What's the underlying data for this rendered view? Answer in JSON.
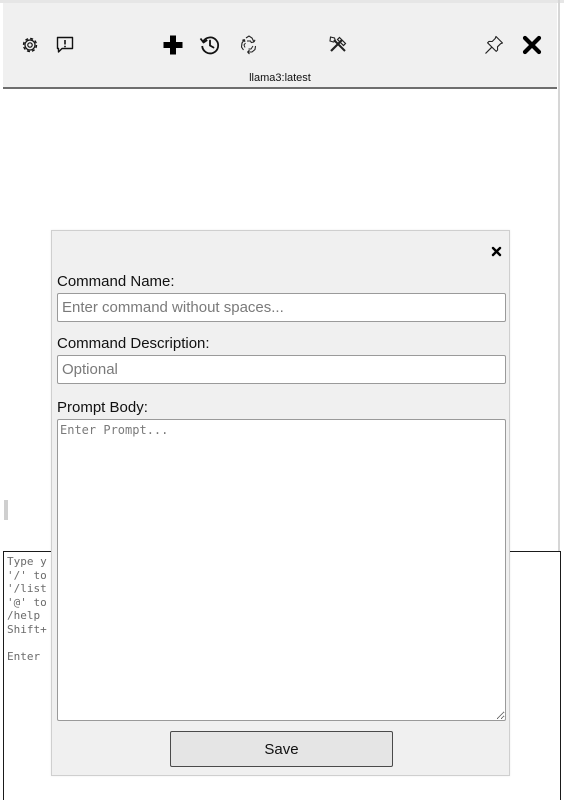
{
  "toolbar": {
    "model_name": "llama3:latest",
    "icons": [
      "gear-icon",
      "feedback-icon",
      "plus-icon",
      "history-icon",
      "recycle-icon",
      "tools-icon",
      "pin-icon",
      "close-icon"
    ]
  },
  "chat_input": {
    "placeholder_lines": "Type y\n'/' to\n'/list\n'@' to\n/help \nShift+\n\nEnter "
  },
  "modal": {
    "command_name_label": "Command Name:",
    "command_name_placeholder": "Enter command without spaces...",
    "command_description_label": "Command Description:",
    "command_description_placeholder": "Optional",
    "prompt_body_label": "Prompt Body:",
    "prompt_body_placeholder": "Enter Prompt...",
    "save_label": "Save"
  }
}
